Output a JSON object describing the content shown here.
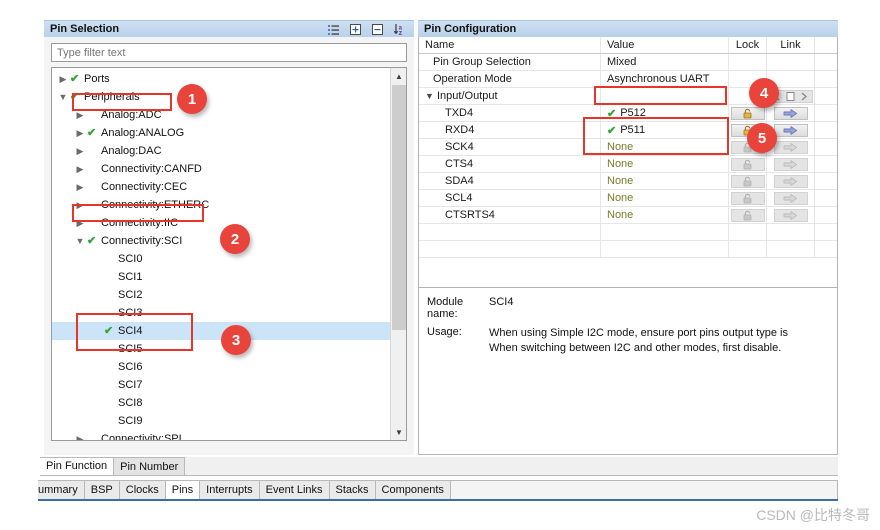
{
  "pin_selection": {
    "title": "Pin Selection",
    "toolbar": [
      {
        "name": "group-list-icon",
        "tip": "Group by"
      },
      {
        "name": "expand-all-icon",
        "tip": "Expand All"
      },
      {
        "name": "collapse-all-icon",
        "tip": "Collapse All"
      },
      {
        "name": "sort-alpha-icon",
        "tip": "Sort"
      }
    ],
    "filter_placeholder": "Type filter text",
    "filter_value": "",
    "tree": [
      {
        "label": "Ports",
        "indent": 0,
        "twisty": "collapsed",
        "check": true,
        "selected": false
      },
      {
        "label": "Peripherals",
        "indent": 0,
        "twisty": "expanded",
        "check": true,
        "selected": false
      },
      {
        "label": "Analog:ADC",
        "indent": 1,
        "twisty": "collapsed",
        "check": false,
        "selected": false
      },
      {
        "label": "Analog:ANALOG",
        "indent": 1,
        "twisty": "collapsed",
        "check": true,
        "selected": false
      },
      {
        "label": "Analog:DAC",
        "indent": 1,
        "twisty": "collapsed",
        "check": false,
        "selected": false
      },
      {
        "label": "Connectivity:CANFD",
        "indent": 1,
        "twisty": "collapsed",
        "check": false,
        "selected": false
      },
      {
        "label": "Connectivity:CEC",
        "indent": 1,
        "twisty": "collapsed",
        "check": false,
        "selected": false
      },
      {
        "label": "Connectivity:ETHERC",
        "indent": 1,
        "twisty": "collapsed",
        "check": false,
        "selected": false
      },
      {
        "label": "Connectivity:IIC",
        "indent": 1,
        "twisty": "collapsed",
        "check": false,
        "selected": false
      },
      {
        "label": "Connectivity:SCI",
        "indent": 1,
        "twisty": "expanded",
        "check": true,
        "selected": false
      },
      {
        "label": "SCI0",
        "indent": 2,
        "twisty": "none",
        "check": false,
        "selected": false
      },
      {
        "label": "SCI1",
        "indent": 2,
        "twisty": "none",
        "check": false,
        "selected": false
      },
      {
        "label": "SCI2",
        "indent": 2,
        "twisty": "none",
        "check": false,
        "selected": false
      },
      {
        "label": "SCI3",
        "indent": 2,
        "twisty": "none",
        "check": false,
        "selected": false
      },
      {
        "label": "SCI4",
        "indent": 2,
        "twisty": "none",
        "check": true,
        "selected": true
      },
      {
        "label": "SCI5",
        "indent": 2,
        "twisty": "none",
        "check": false,
        "selected": false
      },
      {
        "label": "SCI6",
        "indent": 2,
        "twisty": "none",
        "check": false,
        "selected": false
      },
      {
        "label": "SCI7",
        "indent": 2,
        "twisty": "none",
        "check": false,
        "selected": false
      },
      {
        "label": "SCI8",
        "indent": 2,
        "twisty": "none",
        "check": false,
        "selected": false
      },
      {
        "label": "SCI9",
        "indent": 2,
        "twisty": "none",
        "check": false,
        "selected": false
      },
      {
        "label": "Connectivity:SPI",
        "indent": 1,
        "twisty": "collapsed",
        "check": false,
        "selected": false
      }
    ]
  },
  "pin_configuration": {
    "title": "Pin Configuration",
    "columns": [
      "Name",
      "Value",
      "Lock",
      "Link"
    ],
    "rows": [
      {
        "name": "Pin Group Selection",
        "value": "Mixed",
        "indent": 1,
        "twisty": "none",
        "value_check": false,
        "value_none": false,
        "lock": "none",
        "link": "none"
      },
      {
        "name": "Operation Mode",
        "value": "Asynchronous UART",
        "indent": 1,
        "twisty": "none",
        "value_check": false,
        "value_none": false,
        "lock": "none",
        "link": "none"
      },
      {
        "name": "Input/Output",
        "value": "",
        "indent": 0,
        "twisty": "expanded",
        "value_check": false,
        "value_none": false,
        "lock": "none",
        "link": "nav"
      },
      {
        "name": "TXD4",
        "value": "P512",
        "indent": 2,
        "twisty": "none",
        "value_check": true,
        "value_none": false,
        "lock": "open",
        "link": "arrow"
      },
      {
        "name": "RXD4",
        "value": "P511",
        "indent": 2,
        "twisty": "none",
        "value_check": true,
        "value_none": false,
        "lock": "open",
        "link": "arrow"
      },
      {
        "name": "SCK4",
        "value": "None",
        "indent": 2,
        "twisty": "none",
        "value_check": false,
        "value_none": true,
        "lock": "dim",
        "link": "arrowdim"
      },
      {
        "name": "CTS4",
        "value": "None",
        "indent": 2,
        "twisty": "none",
        "value_check": false,
        "value_none": true,
        "lock": "dim",
        "link": "arrowdim"
      },
      {
        "name": "SDA4",
        "value": "None",
        "indent": 2,
        "twisty": "none",
        "value_check": false,
        "value_none": true,
        "lock": "dim",
        "link": "arrowdim"
      },
      {
        "name": "SCL4",
        "value": "None",
        "indent": 2,
        "twisty": "none",
        "value_check": false,
        "value_none": true,
        "lock": "dim",
        "link": "arrowdim"
      },
      {
        "name": "CTSRTS4",
        "value": "None",
        "indent": 2,
        "twisty": "none",
        "value_check": false,
        "value_none": true,
        "lock": "dim",
        "link": "arrowdim"
      }
    ],
    "info": {
      "module_label": "Module name:",
      "module_value": "SCI4",
      "usage_label": "Usage:",
      "usage_line1": "When using Simple I2C mode, ensure port pins output type is",
      "usage_line2": "When switching between I2C and other modes, first disable."
    }
  },
  "sub_tabs": [
    {
      "label": "Pin Function",
      "active": true
    },
    {
      "label": "Pin Number",
      "active": false
    }
  ],
  "work_tabs": [
    {
      "label": "ummary",
      "active": false,
      "clipped": true
    },
    {
      "label": "BSP",
      "active": false,
      "clipped": false
    },
    {
      "label": "Clocks",
      "active": false,
      "clipped": false
    },
    {
      "label": "Pins",
      "active": true,
      "clipped": false
    },
    {
      "label": "Interrupts",
      "active": false,
      "clipped": false
    },
    {
      "label": "Event Links",
      "active": false,
      "clipped": false
    },
    {
      "label": "Stacks",
      "active": false,
      "clipped": false
    },
    {
      "label": "Components",
      "active": false,
      "clipped": false
    }
  ],
  "annotations": [
    {
      "number": "1",
      "target": "peripherals-node"
    },
    {
      "number": "2",
      "target": "connectivity-sci-node"
    },
    {
      "number": "3",
      "target": "sci4-node"
    },
    {
      "number": "4",
      "target": "operation-mode-value"
    },
    {
      "number": "5",
      "target": "txd4-rxd4-values"
    }
  ],
  "watermark": "CSDN @比特冬哥",
  "colors": {
    "accent": "#e8443c",
    "selection": "#cce4f7",
    "header": "#c3d8ee",
    "check": "#2ea832",
    "none_value": "#7a7a28"
  }
}
